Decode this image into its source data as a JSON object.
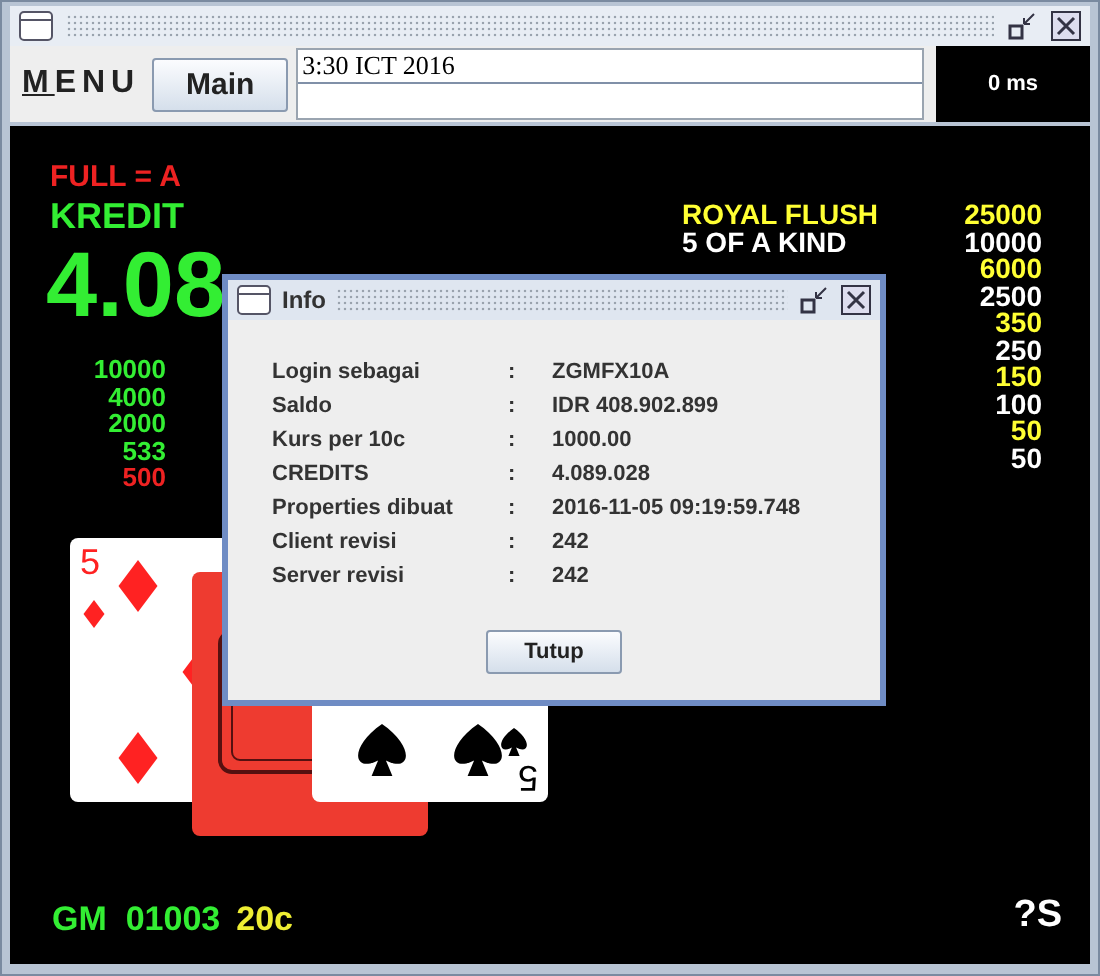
{
  "toolbar": {
    "menu": "MENU",
    "main_button": "Main",
    "status_field": {
      "value": "3:30 ICT 2016"
    },
    "latency": "0 ms"
  },
  "game": {
    "full_label": "FULL = A",
    "credit_label": "KREDIT",
    "credit_value": "4.08",
    "bets": [
      {
        "value": "10000",
        "color": "#33ee33"
      },
      {
        "value": "4000",
        "color": "#33ee33"
      },
      {
        "value": "2000",
        "color": "#33ee33"
      },
      {
        "value": "533",
        "color": "#33ee33"
      },
      {
        "value": "500",
        "color": "#ee2222"
      }
    ],
    "paytable": [
      {
        "hand": "ROYAL FLUSH",
        "payout": "25000",
        "color": "#ffff33"
      },
      {
        "hand": "5 OF A KIND",
        "payout": "10000",
        "color": "#ffffff"
      },
      {
        "payout": "6000",
        "color": "#ffff33"
      },
      {
        "payout": "2500",
        "color": "#ffffff"
      },
      {
        "payout": "350",
        "color": "#ffff33"
      },
      {
        "payout": "250",
        "color": "#ffffff"
      },
      {
        "payout": "150",
        "color": "#ffff33"
      },
      {
        "payout": "100",
        "color": "#ffffff"
      },
      {
        "payout": "50",
        "color": "#ffff33"
      },
      {
        "payout": "50",
        "color": "#ffffff"
      }
    ],
    "cards": [
      {
        "kind": "diamonds",
        "rank": "5"
      },
      {
        "kind": "back"
      },
      {
        "kind": "spades",
        "rank": "5"
      }
    ],
    "status": {
      "game_id": "GM  01003",
      "denomination": "20c",
      "help": "?S"
    }
  },
  "dialog": {
    "title": "Info",
    "rows": [
      {
        "label": "Login sebagai",
        "separator": ":",
        "value": "ZGMFX10A"
      },
      {
        "label": "Saldo",
        "separator": ":",
        "value": "IDR 408.902.899"
      },
      {
        "label": "Kurs per 10c",
        "separator": ":",
        "value": "1000.00"
      },
      {
        "label": "CREDITS",
        "separator": ":",
        "value": "4.089.028"
      },
      {
        "label": "Properties dibuat",
        "separator": ":",
        "value": "2016-11-05 09:19:59.748"
      },
      {
        "label": "Client revisi",
        "separator": ":",
        "value": "242"
      },
      {
        "label": "Server revisi",
        "separator": ":",
        "value": "242"
      }
    ],
    "close_button": "Tutup"
  }
}
